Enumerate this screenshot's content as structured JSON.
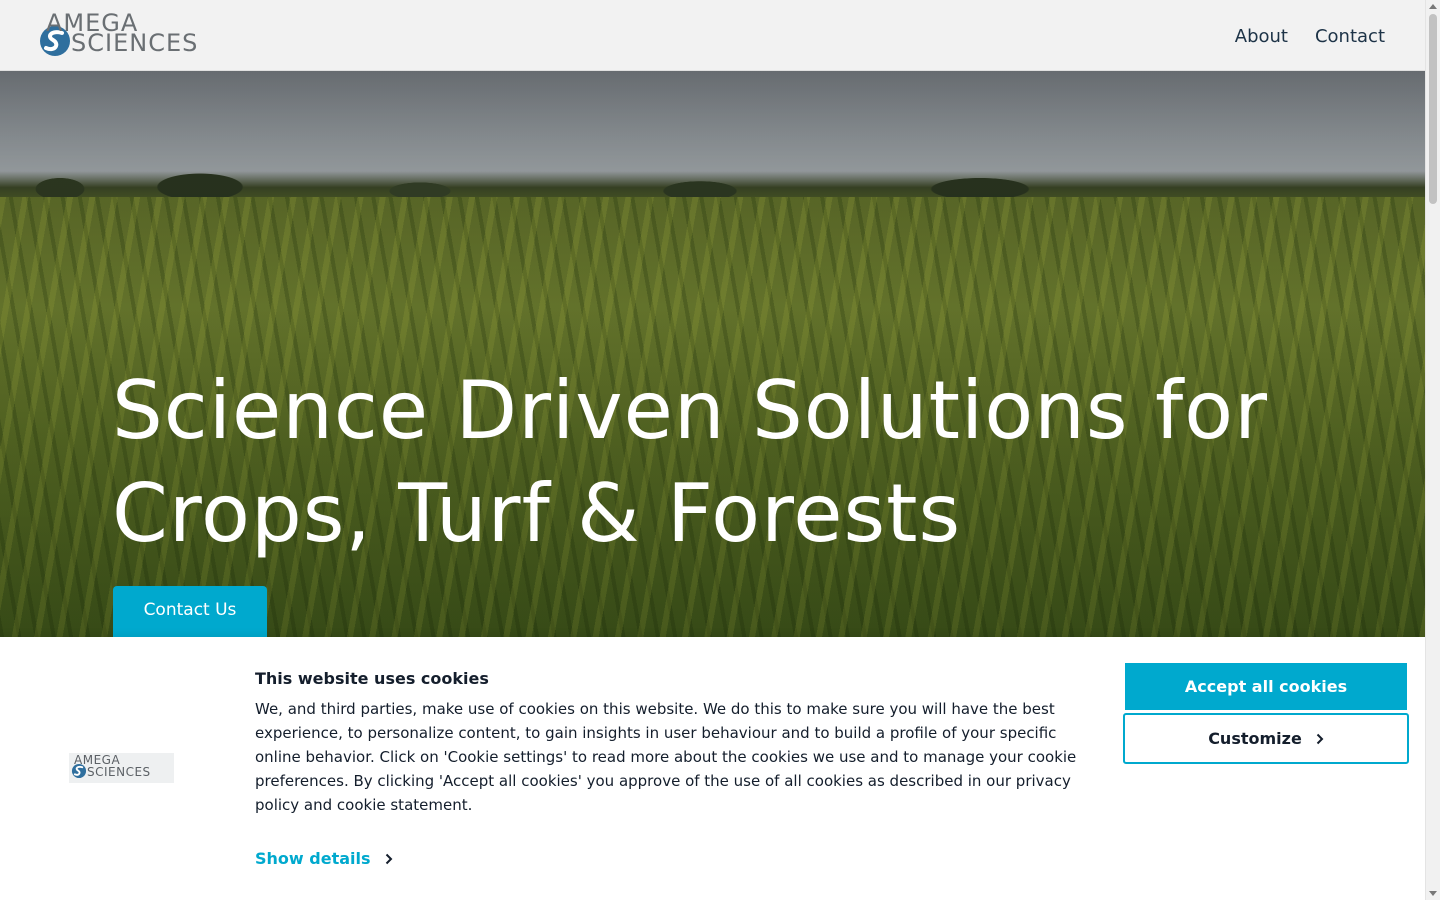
{
  "header": {
    "logo": {
      "line1": "AMEGA",
      "line2": "SCIENCES",
      "icon": "amega-s-logo-icon"
    },
    "nav": [
      {
        "label": "About"
      },
      {
        "label": "Contact"
      }
    ]
  },
  "hero": {
    "title": "Science Driven Solutions for Crops, Turf & Forests",
    "cta_label": "Contact Us"
  },
  "cookie_banner": {
    "logo": {
      "line1": "AMEGA",
      "line2": "SCIENCES"
    },
    "title": "This website uses cookies",
    "text": "We, and third parties, make use of cookies on this website. We do this to make sure you will have the best experience, to personalize content, to gain insights in user behaviour and to build a profile of your specific online behavior. Click on 'Cookie settings' to read more about the cookies we use and to manage your cookie preferences. By clicking 'Accept all cookies' you approve of the use of all cookies as described in our privacy policy and cookie statement.",
    "show_details_label": "Show details",
    "accept_label": "Accept all cookies",
    "customize_label": "Customize"
  },
  "colors": {
    "accent": "#00a9ce",
    "header_bg": "#f2f2f2",
    "nav_text": "#1d3347",
    "body_text": "#141e2c"
  }
}
